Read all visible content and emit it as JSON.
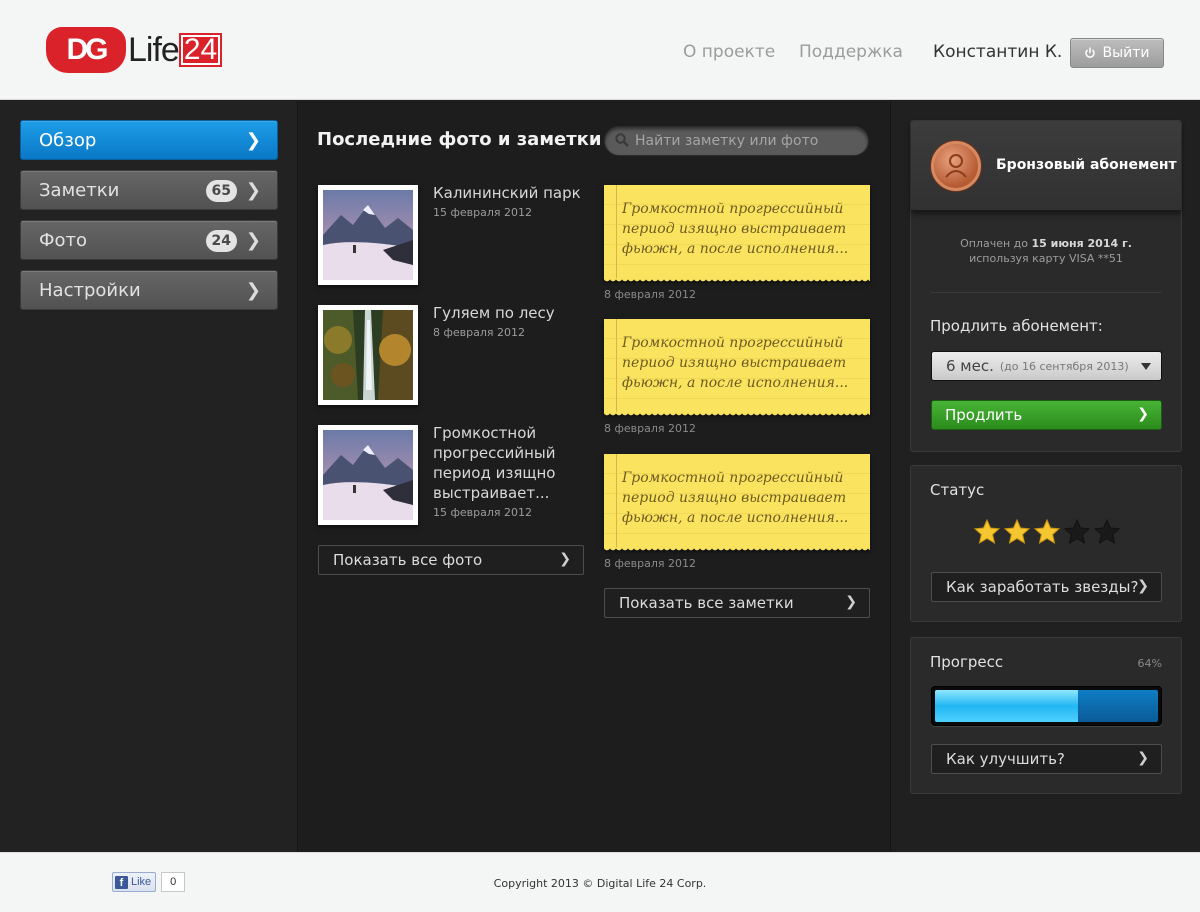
{
  "header": {
    "logo": {
      "dg": "DG",
      "life": "Life",
      "num": "24"
    },
    "nav": [
      "О проекте",
      "Поддержка"
    ],
    "user_name": "Константин К.",
    "logout_label": "Выйти"
  },
  "sidebar": {
    "items": [
      {
        "label": "Обзор",
        "active": true,
        "badge": null
      },
      {
        "label": "Заметки",
        "active": false,
        "badge": "65"
      },
      {
        "label": "Фото",
        "active": false,
        "badge": "24"
      },
      {
        "label": "Настройки",
        "active": false,
        "badge": null
      }
    ]
  },
  "main": {
    "title": "Последние фото и заметки",
    "search_placeholder": "Найти заметку или фото",
    "photos": [
      {
        "title": "Калининский парк",
        "date": "15 февраля 2012",
        "image": "mountain-snow"
      },
      {
        "title": "Гуляем по лесу",
        "date": "8 февраля 2012",
        "image": "forest-waterfall"
      },
      {
        "title": "Громкостной прогрессийный период изящно выстраивает...",
        "date": "15 февраля 2012",
        "image": "mountain-snow"
      }
    ],
    "show_all_photos": "Показать все фото",
    "notes": [
      {
        "text": "Громкостной прогрессийный период изящно выстраивает фьюжн, а после исполнения...",
        "date": "8 февраля 2012"
      },
      {
        "text": "Громкостной прогрессийный период изящно выстраивает фьюжн, а после исполнения...",
        "date": "8 февраля 2012"
      },
      {
        "text": "Громкостной прогрессийный период изящно выстраивает фьюжн, а после исполнения...",
        "date": "8 февраля 2012"
      }
    ],
    "show_all_notes": "Показать все заметки"
  },
  "subscription": {
    "title": "Бронзовый абонемент",
    "paid_prefix": "Оплачен до",
    "paid_until": "15 июня 2014 г.",
    "card_info": "используя карту VISA **51",
    "extend_label": "Продлить абонемент:",
    "period": "6 мес.",
    "period_note": "(до 16 сентября 2013)",
    "extend_button": "Продлить"
  },
  "status": {
    "label": "Статус",
    "stars_filled": 3,
    "stars_total": 5,
    "button": "Как заработать звезды?"
  },
  "progress": {
    "label": "Прогресс",
    "percent_text": "64%",
    "value": 0.64,
    "button": "Как улучшить?"
  },
  "footer": {
    "like_label": "Like",
    "like_count": "0",
    "copyright": "Copyright 2013 © Digital Life 24 Corp."
  },
  "colors": {
    "accent_blue": "#0a78c7",
    "green": "#2b8c1d",
    "brand_red": "#d9222a",
    "star": "#f5c630"
  }
}
